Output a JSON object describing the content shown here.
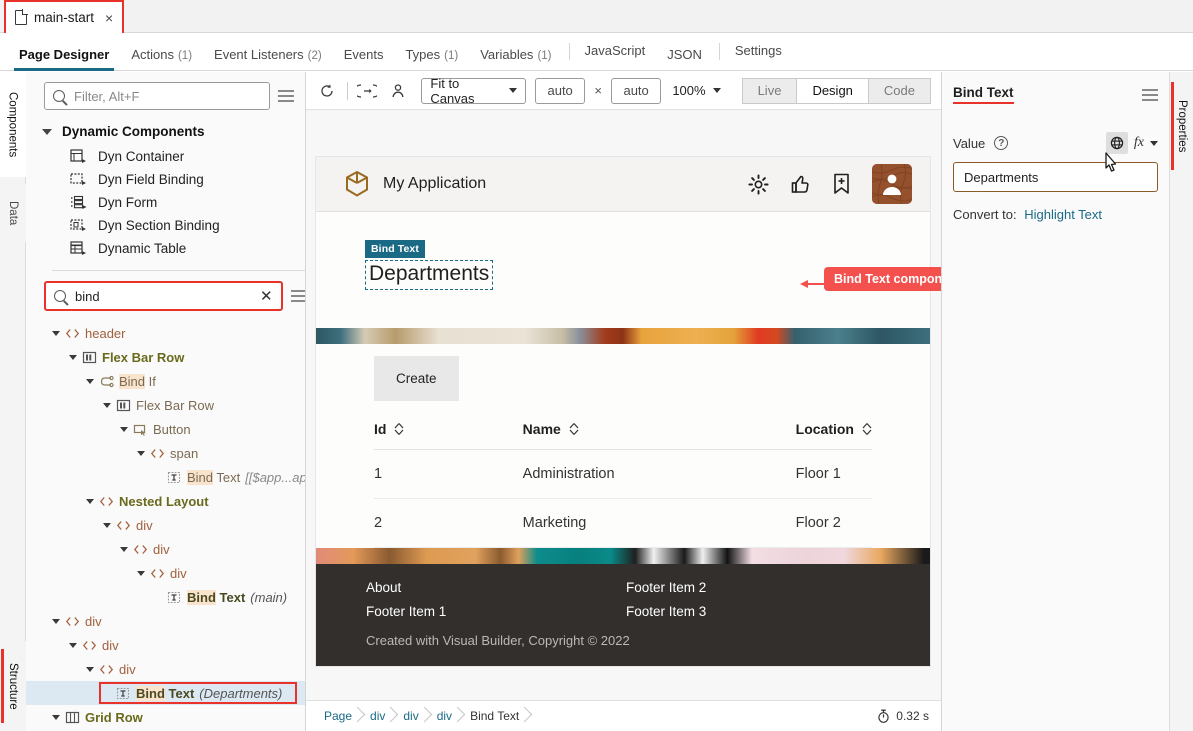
{
  "tab": {
    "label": "main-start",
    "close": "×",
    "icon": "file-icon"
  },
  "maintabs": [
    {
      "label": "Page Designer",
      "count": "",
      "active": true
    },
    {
      "label": "Actions",
      "count": "(1)",
      "active": false
    },
    {
      "label": "Event Listeners",
      "count": "(2)",
      "active": false
    },
    {
      "label": "Events",
      "count": "",
      "active": false
    },
    {
      "label": "Types",
      "count": "(1)",
      "active": false
    },
    {
      "label": "Variables",
      "count": "(1)",
      "active": false
    },
    {
      "label": "JavaScript",
      "count": "",
      "active": false
    },
    {
      "label": "JSON",
      "count": "",
      "active": false
    },
    {
      "label": "Settings",
      "count": "",
      "active": false
    }
  ],
  "leftrail": {
    "components": "Components",
    "data": "Data",
    "structure": "Structure"
  },
  "palette": {
    "filter_placeholder": "Filter, Alt+F",
    "filter_value": "",
    "section_title": "Dynamic Components",
    "items": [
      {
        "label": "Dyn Container",
        "icon": "dyn-container-icon"
      },
      {
        "label": "Dyn Field Binding",
        "icon": "dyn-field-binding-icon"
      },
      {
        "label": "Dyn Form",
        "icon": "dyn-form-icon"
      },
      {
        "label": "Dyn Section Binding",
        "icon": "dyn-section-binding-icon"
      },
      {
        "label": "Dynamic Table",
        "icon": "dynamic-table-icon"
      }
    ]
  },
  "structure": {
    "search_value": "bind",
    "search_placeholder": "",
    "clear_label": "✕",
    "nodes": [
      {
        "indent": 0,
        "caret": true,
        "icon": "code-icon",
        "label": "header",
        "style": "tag",
        "suffix": ""
      },
      {
        "indent": 1,
        "caret": true,
        "icon": "flexbar-icon",
        "label": "Flex Bar Row",
        "style": "bold",
        "suffix": ""
      },
      {
        "indent": 2,
        "caret": true,
        "icon": "bindif-icon",
        "label": "Bind If",
        "style": "hl-norm",
        "suffix": ""
      },
      {
        "indent": 3,
        "caret": true,
        "icon": "flexbar-icon",
        "label": "Flex Bar Row",
        "style": "norm",
        "suffix": ""
      },
      {
        "indent": 4,
        "caret": true,
        "icon": "button-icon",
        "label": "Button",
        "style": "norm",
        "suffix": ""
      },
      {
        "indent": 5,
        "caret": true,
        "icon": "code-icon",
        "label": "span",
        "style": "norm",
        "suffix": ""
      },
      {
        "indent": 6,
        "caret": false,
        "icon": "text-icon",
        "label": "Bind Text",
        "style": "hl-norm",
        "suffix": "[[$app...app_titl"
      },
      {
        "indent": 2,
        "caret": true,
        "icon": "code-icon",
        "label": "Nested Layout",
        "style": "bold",
        "suffix": ""
      },
      {
        "indent": 3,
        "caret": true,
        "icon": "code-icon",
        "label": "div",
        "style": "tag",
        "suffix": ""
      },
      {
        "indent": 4,
        "caret": true,
        "icon": "code-icon",
        "label": "div",
        "style": "tag",
        "suffix": ""
      },
      {
        "indent": 5,
        "caret": true,
        "icon": "code-icon",
        "label": "div",
        "style": "tag",
        "suffix": ""
      },
      {
        "indent": 6,
        "caret": false,
        "icon": "text-icon",
        "label": "Bind Text",
        "style": "hl-bold",
        "suffix": "(main)"
      },
      {
        "indent": 0,
        "caret": true,
        "icon": "code-icon",
        "label": "div",
        "style": "tag",
        "suffix": ""
      },
      {
        "indent": 1,
        "caret": true,
        "icon": "code-icon",
        "label": "div",
        "style": "tag",
        "suffix": ""
      },
      {
        "indent": 2,
        "caret": true,
        "icon": "code-icon",
        "label": "div",
        "style": "tag",
        "suffix": ""
      },
      {
        "indent": 3,
        "caret": false,
        "icon": "text-icon",
        "label": "Bind Text",
        "style": "hl-bold",
        "suffix": "(Departments)",
        "selected": true,
        "boxed": true
      },
      {
        "indent": 0,
        "caret": true,
        "icon": "gridrow-icon",
        "label": "Grid Row",
        "style": "bold",
        "suffix": ""
      }
    ]
  },
  "canvas_toolbar": {
    "refresh_icon": "refresh-icon",
    "navigate_icon": "navigate-icon",
    "user_icon": "user-icon",
    "size_mode": "Fit to Canvas",
    "width_value": "auto",
    "height_value": "auto",
    "multiply": "×",
    "zoom": "100%",
    "modes": [
      {
        "label": "Live",
        "active": false
      },
      {
        "label": "Design",
        "active": true
      },
      {
        "label": "Code",
        "active": false
      }
    ]
  },
  "preview": {
    "app_title": "My Application",
    "logo_icon": "cube-icon",
    "header_icons": [
      "gear-icon",
      "thumbs-up-icon",
      "bookmark-add-icon",
      "avatar"
    ],
    "selection_badge": "Bind Text",
    "page_heading": "Departments",
    "callout": "Bind Text component",
    "create_button": "Create",
    "table": {
      "columns": [
        "Id",
        "Name",
        "Location"
      ],
      "rows": [
        [
          "1",
          "Administration",
          "Floor 1"
        ],
        [
          "2",
          "Marketing",
          "Floor 2"
        ]
      ]
    },
    "footer": {
      "col1": [
        "About",
        "Footer Item 1"
      ],
      "col2": [
        "Footer Item 2",
        "Footer Item 3"
      ],
      "copyright": "Created with Visual Builder, Copyright © 2022"
    }
  },
  "breadcrumb": {
    "items": [
      "Page",
      "div",
      "div",
      "div",
      "Bind Text"
    ],
    "timer": "0.32 s",
    "timer_icon": "stopwatch-icon"
  },
  "properties": {
    "title": "Bind Text",
    "menu_icon": "hamburger-icon",
    "value_label": "Value",
    "help_icon": "help-icon",
    "globe_icon": "globe-icon",
    "fx_label": "fx",
    "value_text": "Departments",
    "convert_label": "Convert to:",
    "convert_link": "Highlight Text",
    "rail_label": "Properties"
  }
}
